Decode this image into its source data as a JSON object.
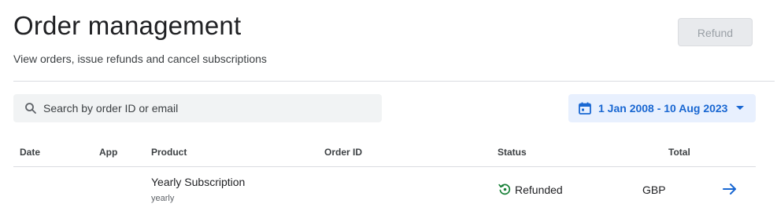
{
  "header": {
    "title": "Order management",
    "subtitle": "View orders, issue refunds and cancel subscriptions",
    "refund_label": "Refund"
  },
  "search": {
    "placeholder": "Search by order ID or email",
    "value": ""
  },
  "date_range": {
    "label": "1 Jan 2008 - 10 Aug 2023"
  },
  "table": {
    "columns": [
      "Date",
      "App",
      "Product",
      "Order ID",
      "Status",
      "Total"
    ],
    "rows": [
      {
        "date": "",
        "app": "",
        "product": "Yearly Subscription",
        "product_detail": "yearly",
        "order_id": "",
        "status": "Refunded",
        "total": "GBP"
      }
    ]
  },
  "colors": {
    "accent": "#1967d2",
    "accent_bg": "#e8f0fe",
    "success": "#188038",
    "search_bg": "#f1f3f4",
    "disabled_bg": "#e8eaed"
  },
  "icons": [
    "search-icon",
    "calendar-icon",
    "chevron-down-icon",
    "refund-status-icon",
    "arrow-right-icon"
  ]
}
